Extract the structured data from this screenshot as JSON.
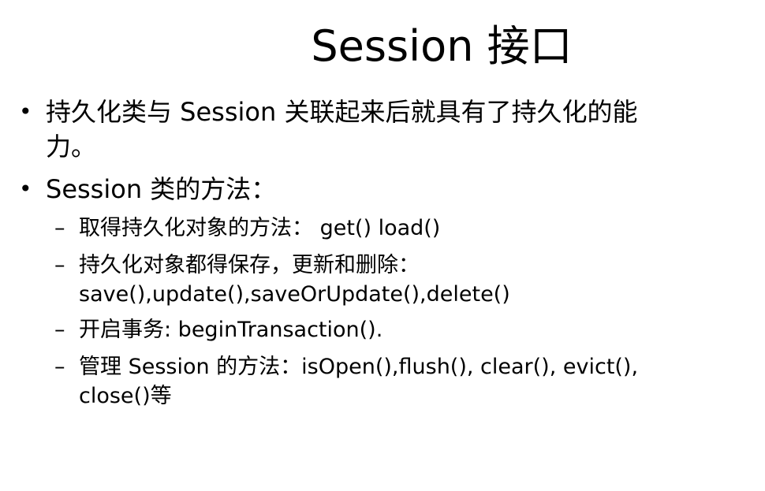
{
  "title": "Session 接口",
  "bullets": [
    {
      "marker": "•",
      "lines": [
        "持久化类与 Session 关联起来后就具有了持久化的能",
        "力。"
      ]
    },
    {
      "marker": "•",
      "lines": [
        "Session 类的方法："
      ],
      "sub_items": [
        {
          "marker": "–",
          "lines": [
            "取得持久化对象的方法： get() load()"
          ]
        },
        {
          "marker": "–",
          "lines": [
            "持久化对象都得保存，更新和删除：",
            "save(),update(),saveOrUpdate(),delete()"
          ]
        },
        {
          "marker": "–",
          "lines": [
            "开启事务: beginTransaction()."
          ]
        },
        {
          "marker": "–",
          "lines": [
            "管理 Session 的方法：isOpen(),flush(), clear(), evict(),",
            "close()等"
          ]
        }
      ]
    }
  ]
}
